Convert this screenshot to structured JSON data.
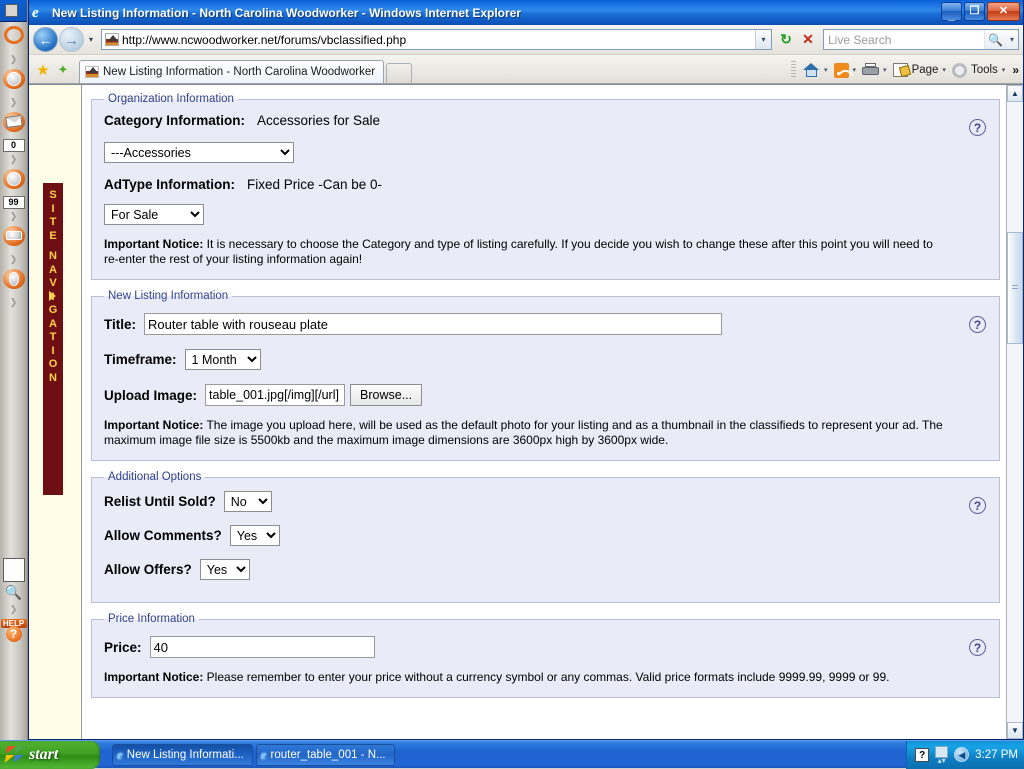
{
  "window": {
    "title": "New Listing Information - North Carolina Woodworker - Windows Internet Explorer",
    "minimize_label": "_",
    "maximize_label": "❐",
    "close_label": "✕"
  },
  "navbar": {
    "back_label": "←",
    "forward_label": "→",
    "history_caret": "▾",
    "url": "http://www.ncwoodworker.net/forums/vbclassified.php",
    "url_dropdown": "▾",
    "refresh_label": "↻",
    "stop_label": "✕",
    "search_placeholder": "Live Search",
    "search_value": "",
    "search_go": "🔍",
    "search_go_caret": "▾"
  },
  "tabs": {
    "favorites_star": "★",
    "add_favorite": "✦",
    "items": [
      {
        "label": "New Listing Information - North Carolina Woodworker",
        "active": true
      }
    ],
    "newtab_label": ""
  },
  "command_bar": {
    "home_label": "",
    "feeds_label": "",
    "print_label": "",
    "page_label": "Page",
    "tools_label": "Tools",
    "overflow_label": "»",
    "caret": "▾"
  },
  "left_toolbar": {
    "items": [
      {
        "name": "planet-icon",
        "badge": null
      },
      {
        "name": "globe-icon",
        "badge": null
      },
      {
        "name": "mail-icon",
        "badge": "0"
      },
      {
        "name": "news-icon",
        "badge": "99"
      },
      {
        "name": "folder-icon",
        "badge": null
      },
      {
        "name": "chess-icon",
        "badge": null
      }
    ],
    "search_placeholder": "",
    "search_value": "",
    "magnifier_icon": "🔍",
    "expand_icon": "❯",
    "help_top_label": "HELP",
    "help_q_label": "?"
  },
  "site_nav": {
    "label": "SITE NAVIGATION",
    "arrow": "▶"
  },
  "page": {
    "help_icon_label": "?",
    "sections": [
      {
        "id": "organization-information",
        "legend": "Organization Information",
        "rows": [
          {
            "type": "label-value",
            "label": "Category Information:",
            "value": "Accessories for Sale"
          },
          {
            "type": "select",
            "name": "category-select",
            "value": "---Accessories",
            "width": 190
          },
          {
            "type": "label-value",
            "label": "AdType Information:",
            "value": "Fixed Price -Can be 0-"
          },
          {
            "type": "select",
            "name": "adtype-select",
            "value": "For Sale",
            "width": 100
          }
        ],
        "notice_label": "Important Notice:",
        "notice_text": " It is necessary to choose the Category and type of listing carefully. If you decide you wish to change these after this point you will need to re-enter the rest of your listing information again!"
      },
      {
        "id": "new-listing-information",
        "legend": "New Listing Information",
        "title_label": "Title:",
        "title_value": "Router table with rouseau plate",
        "timeframe_label": "Timeframe:",
        "timeframe_value": "1 Month",
        "upload_label": "Upload Image:",
        "upload_value": "table_001.jpg[/img][/url]",
        "browse_label": "Browse...",
        "notice_label": "Important Notice:",
        "notice_text": " The image you upload here, will be used as the default photo for your listing and as a thumbnail in the classifieds to represent your ad. The maximum image file size is 5500kb and the maximum image dimensions are 3600px high by 3600px wide."
      },
      {
        "id": "additional-options",
        "legend": "Additional Options",
        "options": [
          {
            "label": "Relist Until Sold?",
            "value": "No",
            "name": "relist-select"
          },
          {
            "label": "Allow Comments?",
            "value": "Yes",
            "name": "comments-select"
          },
          {
            "label": "Allow Offers?",
            "value": "Yes",
            "name": "offers-select"
          }
        ]
      },
      {
        "id": "price-information",
        "legend": "Price Information",
        "price_label": "Price:",
        "price_value": "40",
        "notice_label": "Important Notice:",
        "notice_text": " Please remember to enter your price without a currency symbol or any commas. Valid price formats include 9999.99, 9999 or 99."
      }
    ]
  },
  "scrollbar": {
    "up_label": "▲",
    "down_label": "▼"
  },
  "taskbar": {
    "start_label": "start",
    "items": [
      {
        "label": "New Listing Informati...",
        "active": true
      },
      {
        "label": "router_table_001 - N...",
        "active": false
      }
    ],
    "tray": {
      "help_label": "?",
      "updown_label": "▴▾",
      "volume_label": "◀",
      "clock": "3:27 PM"
    }
  },
  "colors": {
    "titlebar_blue": "#1268e0",
    "fieldset_bg": "#e9ecf7",
    "fieldset_border": "#b9c0d6",
    "legend_text": "#31428f",
    "sitenav_maroon": "#6e0f14",
    "sitenav_text": "#ffd24a",
    "page_margin": "#fffde8",
    "taskbar_blue": "#1d62cf",
    "start_green": "#3f9f23"
  }
}
